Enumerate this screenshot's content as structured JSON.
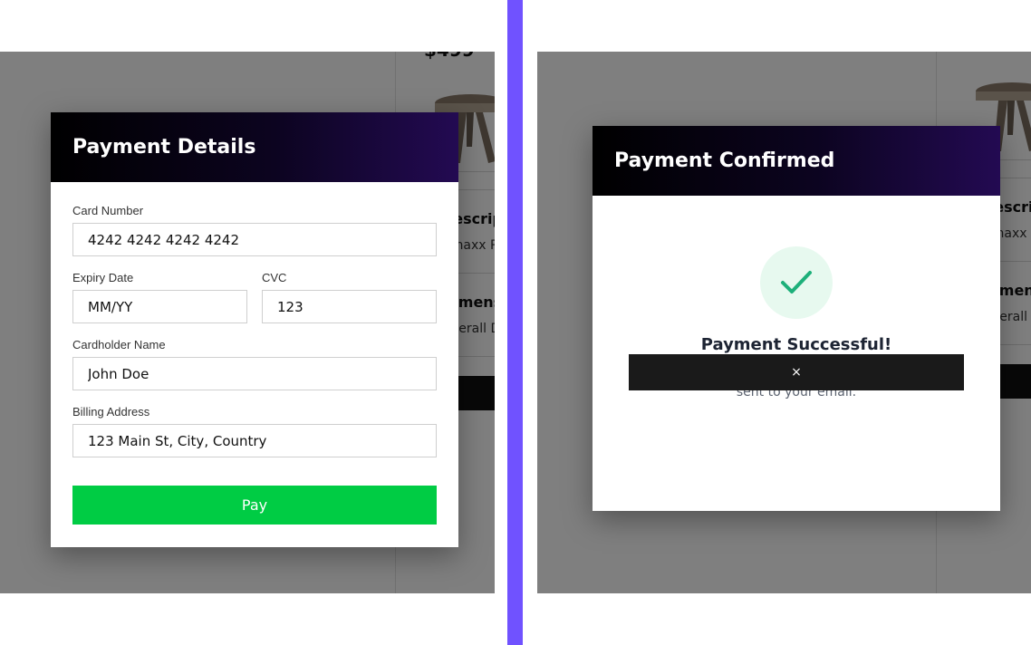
{
  "background": {
    "price": "$499",
    "heading_description": "Description",
    "text_description": "Dmaxx Room",
    "heading_dimensions": "Dimensions",
    "text_dimensions": "Overall Dimensions"
  },
  "payment_modal": {
    "title": "Payment Details",
    "card_number_label": "Card Number",
    "card_number_value": "4242 4242 4242 4242",
    "expiry_label": "Expiry Date",
    "expiry_placeholder": "MM/YY",
    "cvc_label": "CVC",
    "cvc_value": "123",
    "cardholder_label": "Cardholder Name",
    "cardholder_value": "John Doe",
    "billing_label": "Billing Address",
    "billing_value": "123 Main St, City, Country",
    "pay_label": "Pay"
  },
  "confirm_modal": {
    "title": "Payment Confirmed",
    "success_title": "Payment Successful!",
    "success_message": "Thank you for your purchase. A receipt has been sent to your email.",
    "close_label": "×",
    "icon": "checkmark-icon"
  },
  "colors": {
    "accent_divider": "#7052ff",
    "pay_button": "#00cc44",
    "check": "#1db07a"
  }
}
